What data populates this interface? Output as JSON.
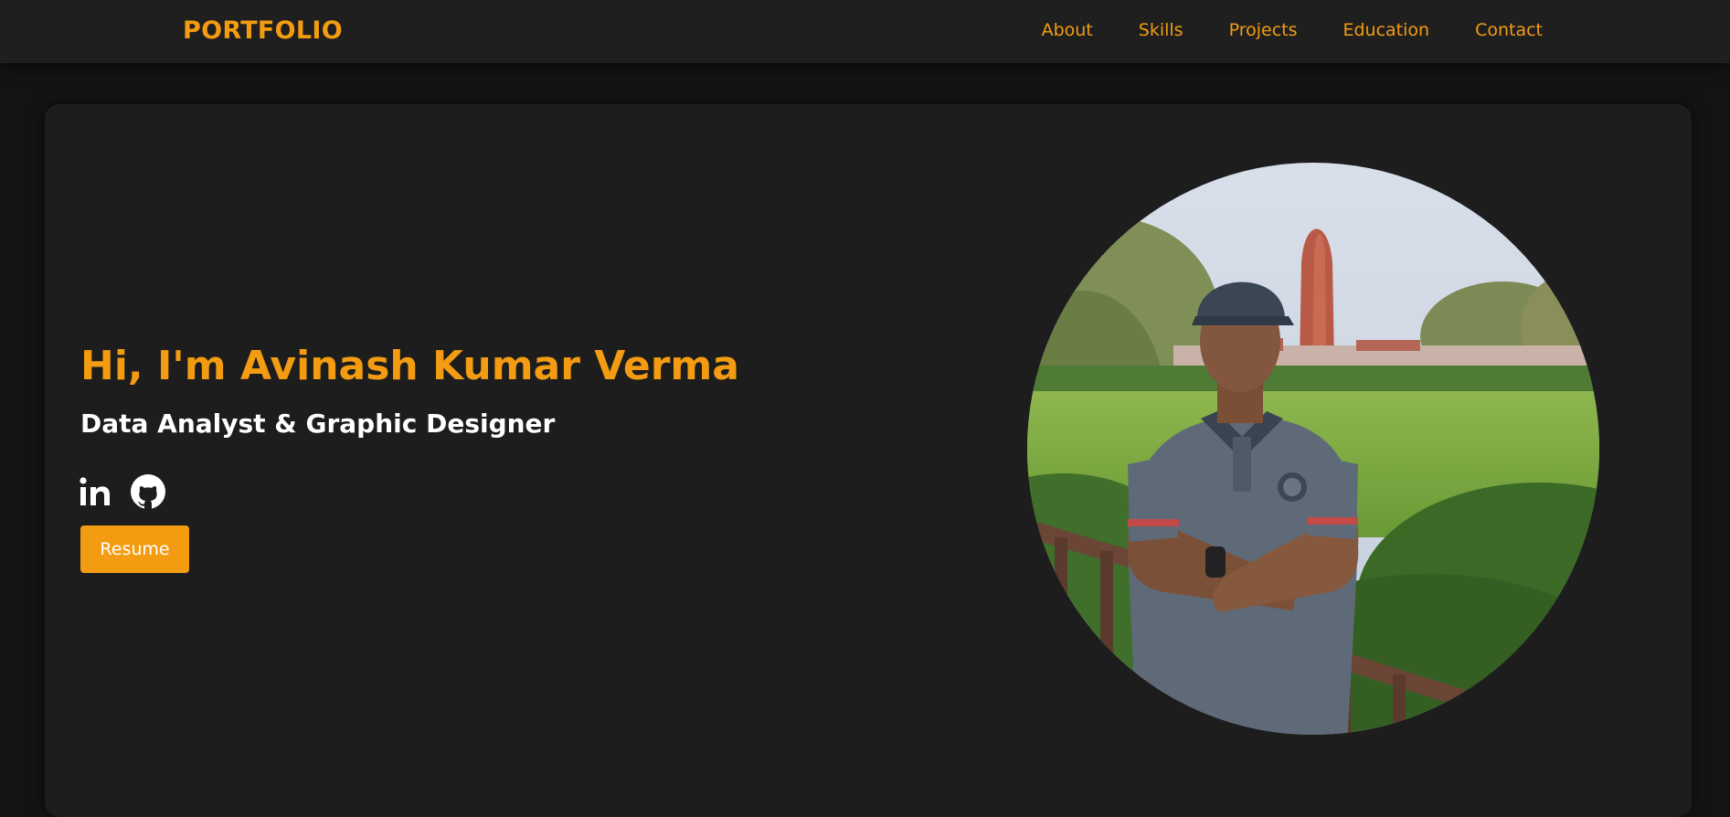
{
  "nav": {
    "brand": "PORTFOLIO",
    "links": [
      {
        "label": "About"
      },
      {
        "label": "Skills"
      },
      {
        "label": "Projects"
      },
      {
        "label": "Education"
      },
      {
        "label": "Contact"
      }
    ]
  },
  "hero": {
    "title": "Hi, I'm Avinash Kumar Verma",
    "subtitle": "Data Analyst & Graphic Designer",
    "socials": [
      {
        "icon": "linkedin-icon"
      },
      {
        "icon": "github-icon"
      }
    ],
    "resume_label": "Resume",
    "photo_alt": "Avinash Kumar Verma"
  },
  "colors": {
    "accent": "#f39c12",
    "background": "#141414",
    "card": "#1d1d1d",
    "navbar": "#1f1f1f",
    "text": "#ffffff"
  }
}
